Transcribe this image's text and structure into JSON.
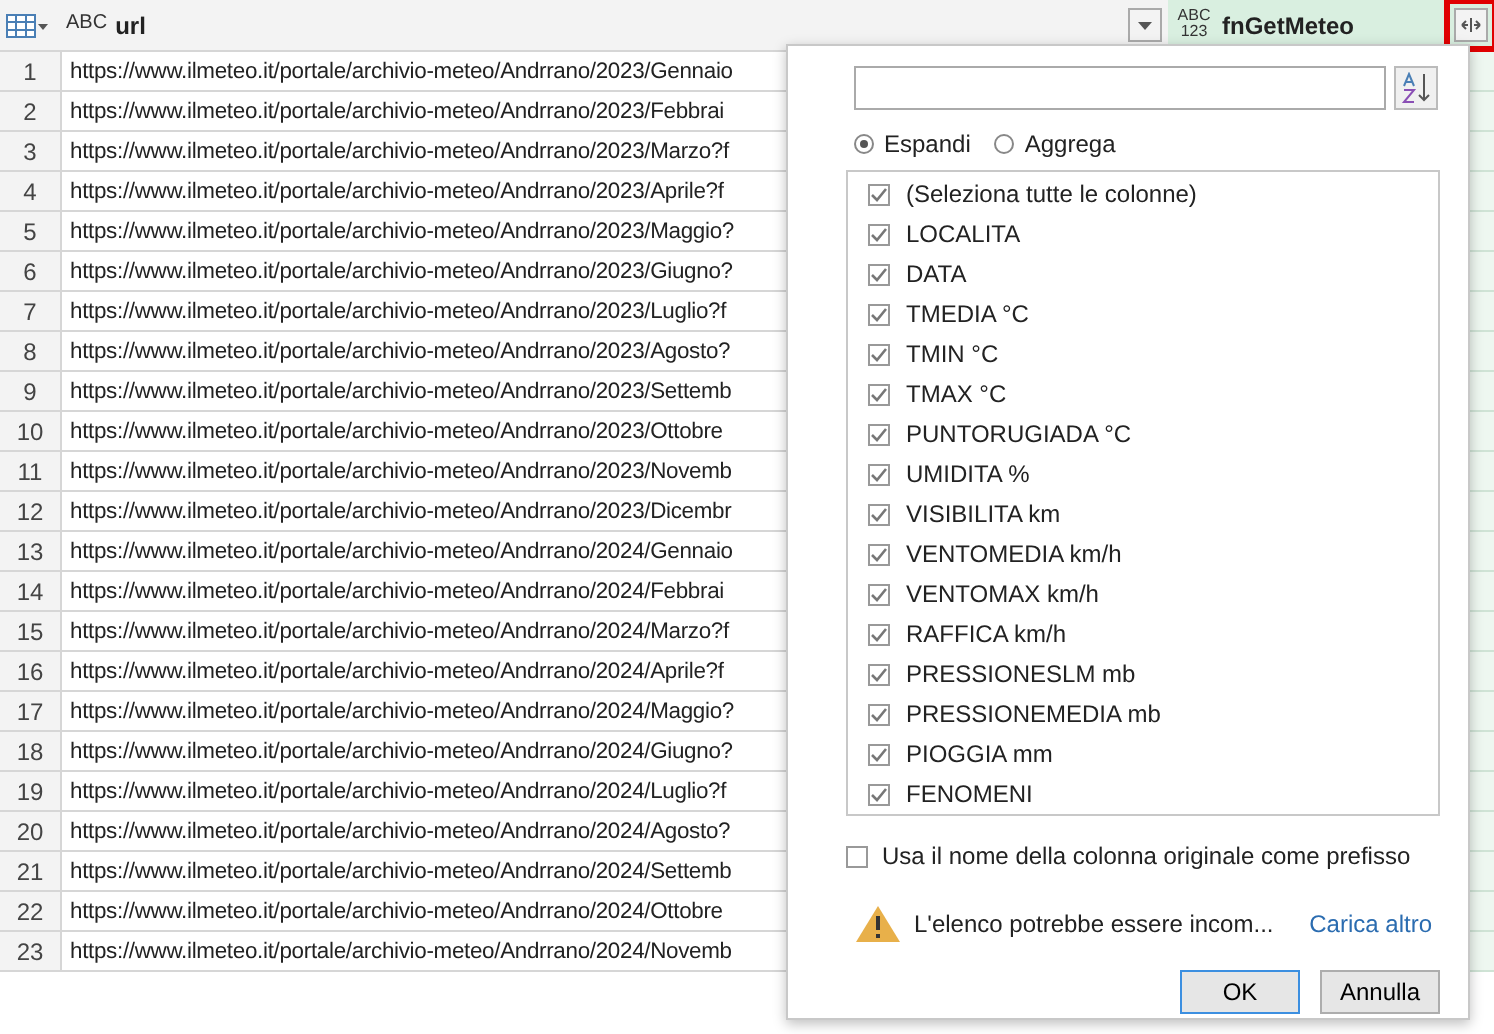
{
  "table": {
    "columns": [
      {
        "kind": "text",
        "type_label": "ABC",
        "name": "url"
      },
      {
        "kind": "any",
        "type_label": "ABC 123",
        "name": "fnGetMeteo"
      }
    ],
    "rows": [
      {
        "number": "1",
        "url": "https://www.ilmeteo.it/portale/archivio-meteo/Andrrano/2023/Gennaio"
      },
      {
        "number": "2",
        "url": "https://www.ilmeteo.it/portale/archivio-meteo/Andrrano/2023/Febbrai"
      },
      {
        "number": "3",
        "url": "https://www.ilmeteo.it/portale/archivio-meteo/Andrrano/2023/Marzo?f"
      },
      {
        "number": "4",
        "url": "https://www.ilmeteo.it/portale/archivio-meteo/Andrrano/2023/Aprile?f"
      },
      {
        "number": "5",
        "url": "https://www.ilmeteo.it/portale/archivio-meteo/Andrrano/2023/Maggio?"
      },
      {
        "number": "6",
        "url": "https://www.ilmeteo.it/portale/archivio-meteo/Andrrano/2023/Giugno?"
      },
      {
        "number": "7",
        "url": "https://www.ilmeteo.it/portale/archivio-meteo/Andrrano/2023/Luglio?f"
      },
      {
        "number": "8",
        "url": "https://www.ilmeteo.it/portale/archivio-meteo/Andrrano/2023/Agosto?"
      },
      {
        "number": "9",
        "url": "https://www.ilmeteo.it/portale/archivio-meteo/Andrrano/2023/Settemb"
      },
      {
        "number": "10",
        "url": "https://www.ilmeteo.it/portale/archivio-meteo/Andrrano/2023/Ottobre"
      },
      {
        "number": "11",
        "url": "https://www.ilmeteo.it/portale/archivio-meteo/Andrrano/2023/Novemb"
      },
      {
        "number": "12",
        "url": "https://www.ilmeteo.it/portale/archivio-meteo/Andrrano/2023/Dicembr"
      },
      {
        "number": "13",
        "url": "https://www.ilmeteo.it/portale/archivio-meteo/Andrrano/2024/Gennaio"
      },
      {
        "number": "14",
        "url": "https://www.ilmeteo.it/portale/archivio-meteo/Andrrano/2024/Febbrai"
      },
      {
        "number": "15",
        "url": "https://www.ilmeteo.it/portale/archivio-meteo/Andrrano/2024/Marzo?f"
      },
      {
        "number": "16",
        "url": "https://www.ilmeteo.it/portale/archivio-meteo/Andrrano/2024/Aprile?f"
      },
      {
        "number": "17",
        "url": "https://www.ilmeteo.it/portale/archivio-meteo/Andrrano/2024/Maggio?"
      },
      {
        "number": "18",
        "url": "https://www.ilmeteo.it/portale/archivio-meteo/Andrrano/2024/Giugno?"
      },
      {
        "number": "19",
        "url": "https://www.ilmeteo.it/portale/archivio-meteo/Andrrano/2024/Luglio?f"
      },
      {
        "number": "20",
        "url": "https://www.ilmeteo.it/portale/archivio-meteo/Andrrano/2024/Agosto?"
      },
      {
        "number": "21",
        "url": "https://www.ilmeteo.it/portale/archivio-meteo/Andrrano/2024/Settemb"
      },
      {
        "number": "22",
        "url": "https://www.ilmeteo.it/portale/archivio-meteo/Andrrano/2024/Ottobre"
      },
      {
        "number": "23",
        "url": "https://www.ilmeteo.it/portale/archivio-meteo/Andrrano/2024/Novemb"
      }
    ]
  },
  "expand_panel": {
    "modes": [
      {
        "label": "Espandi",
        "selected": true
      },
      {
        "label": "Aggrega",
        "selected": false
      }
    ],
    "columns": [
      {
        "label": "(Seleziona tutte le colonne)",
        "checked": true
      },
      {
        "label": "LOCALITA",
        "checked": true
      },
      {
        "label": "DATA",
        "checked": true
      },
      {
        "label": "TMEDIA °C",
        "checked": true
      },
      {
        "label": "TMIN °C",
        "checked": true
      },
      {
        "label": "TMAX °C",
        "checked": true
      },
      {
        "label": "PUNTORUGIADA °C",
        "checked": true
      },
      {
        "label": "UMIDITA %",
        "checked": true
      },
      {
        "label": "VISIBILITA km",
        "checked": true
      },
      {
        "label": "VENTOMEDIA km/h",
        "checked": true
      },
      {
        "label": "VENTOMAX km/h",
        "checked": true
      },
      {
        "label": "RAFFICA km/h",
        "checked": true
      },
      {
        "label": "PRESSIONESLM mb",
        "checked": true
      },
      {
        "label": "PRESSIONEMEDIA mb",
        "checked": true
      },
      {
        "label": "PIOGGIA mm",
        "checked": true
      },
      {
        "label": "FENOMENI",
        "checked": true
      }
    ],
    "prefix_option": {
      "label": "Usa il nome della colonna originale come prefisso",
      "checked": false
    },
    "warning": "L'elenco potrebbe essere incom...",
    "load_more": "Carica altro",
    "buttons": [
      {
        "label": "OK",
        "primary": true
      },
      {
        "label": "Annulla",
        "primary": false
      }
    ]
  }
}
